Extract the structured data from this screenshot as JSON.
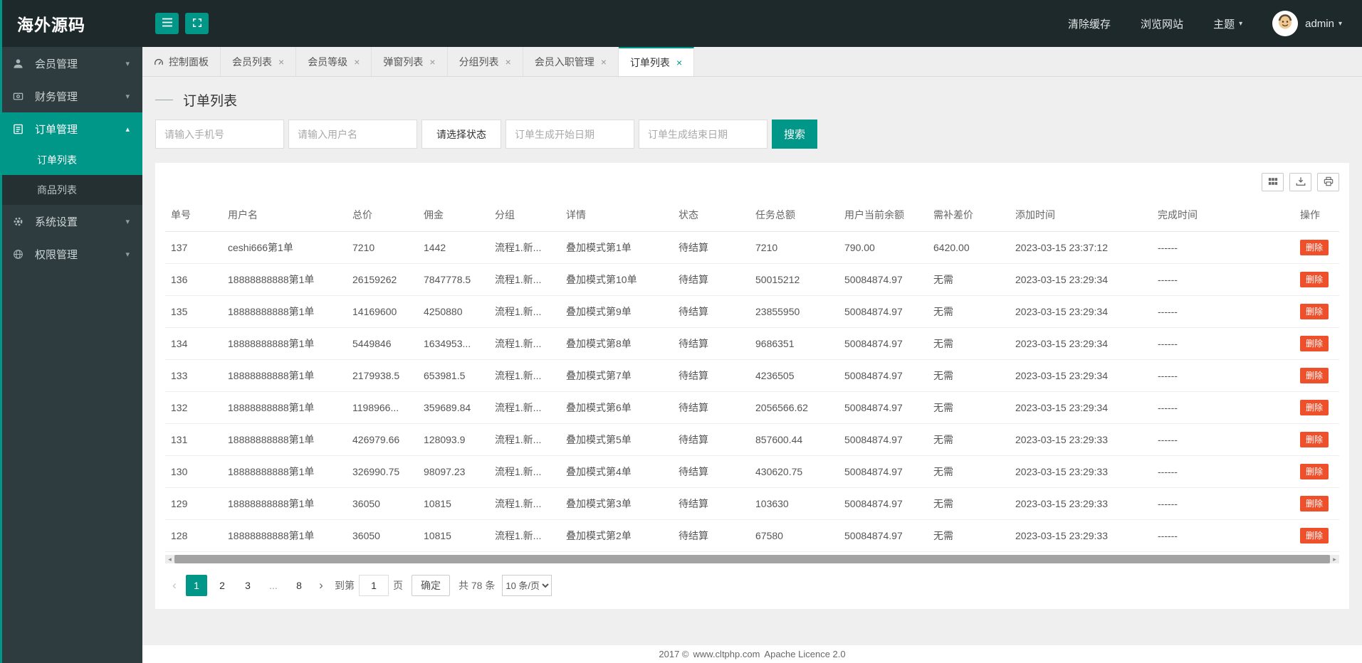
{
  "colors": {
    "accent": "#009688",
    "danger": "#ef502c",
    "topbar_bg": "#1e292c",
    "sidebar_bg": "#2f3c3f",
    "submenu_bg": "#253033"
  },
  "icons": {
    "close": "×",
    "caret_down": "▾",
    "caret_up": "▴",
    "prev": "‹",
    "next": "›",
    "scroll_left": "◂",
    "scroll_right": "▸"
  },
  "brand": {
    "logo_text": "海外源码"
  },
  "topbar": {
    "links": [
      {
        "id": "clear-cache",
        "label": "清除缓存"
      },
      {
        "id": "browse-site",
        "label": "浏览网站"
      }
    ],
    "theme": {
      "label": "主题"
    },
    "user": {
      "name": "admin"
    }
  },
  "sidebar": {
    "items": [
      {
        "id": "members",
        "label": "会员管理",
        "icon": "user-icon",
        "expanded": false,
        "active": false
      },
      {
        "id": "finance",
        "label": "财务管理",
        "icon": "finance-icon",
        "expanded": false,
        "active": false
      },
      {
        "id": "orders",
        "label": "订单管理",
        "icon": "order-icon",
        "expanded": true,
        "active": true,
        "children": [
          {
            "id": "order-list",
            "label": "订单列表",
            "active": true
          },
          {
            "id": "product-list",
            "label": "商品列表",
            "active": false
          }
        ]
      },
      {
        "id": "system",
        "label": "系统设置",
        "icon": "settings-icon",
        "expanded": false,
        "active": false
      },
      {
        "id": "permissions",
        "label": "权限管理",
        "icon": "globe-icon",
        "expanded": false,
        "active": false
      }
    ]
  },
  "tabs": [
    {
      "id": "dashboard",
      "label": "控制面板",
      "icon": "dashboard-icon",
      "closable": false,
      "active": false
    },
    {
      "id": "member-list",
      "label": "会员列表",
      "closable": true,
      "active": false
    },
    {
      "id": "member-level",
      "label": "会员等级",
      "closable": true,
      "active": false
    },
    {
      "id": "popup-list",
      "label": "弹窗列表",
      "closable": true,
      "active": false
    },
    {
      "id": "group-list",
      "label": "分组列表",
      "closable": true,
      "active": false
    },
    {
      "id": "member-onboarding",
      "label": "会员入职管理",
      "closable": true,
      "active": false
    },
    {
      "id": "order-list",
      "label": "订单列表",
      "closable": true,
      "active": true
    }
  ],
  "page": {
    "title": "订单列表"
  },
  "filters": {
    "phone_placeholder": "请输入手机号",
    "username_placeholder": "请输入用户名",
    "status_button_label": "请选择状态",
    "start_date_placeholder": "订单生成开始日期",
    "end_date_placeholder": "订单生成结束日期",
    "search_button_label": "搜索"
  },
  "toolbar_icons": [
    "columns-icon",
    "download-icon",
    "print-icon"
  ],
  "table": {
    "columns": [
      "单号",
      "用户名",
      "总价",
      "佣金",
      "分组",
      "详情",
      "状态",
      "任务总额",
      "用户当前余额",
      "需补差价",
      "添加时间",
      "完成时间",
      "操作"
    ],
    "delete_button_label": "删除",
    "rows": [
      [
        "137",
        "ceshi666第1单",
        "7210",
        "1442",
        "流程1.新...",
        "叠加模式第1单",
        "待结算",
        "7210",
        "790.00",
        "6420.00",
        "2023-03-15 23:37:12",
        "------"
      ],
      [
        "136",
        "18888888888第1单",
        "26159262",
        "7847778.5",
        "流程1.新...",
        "叠加模式第10单",
        "待结算",
        "50015212",
        "50084874.97",
        "无需",
        "2023-03-15 23:29:34",
        "------"
      ],
      [
        "135",
        "18888888888第1单",
        "14169600",
        "4250880",
        "流程1.新...",
        "叠加模式第9单",
        "待结算",
        "23855950",
        "50084874.97",
        "无需",
        "2023-03-15 23:29:34",
        "------"
      ],
      [
        "134",
        "18888888888第1单",
        "5449846",
        "1634953...",
        "流程1.新...",
        "叠加模式第8单",
        "待结算",
        "9686351",
        "50084874.97",
        "无需",
        "2023-03-15 23:29:34",
        "------"
      ],
      [
        "133",
        "18888888888第1单",
        "2179938.5",
        "653981.5",
        "流程1.新...",
        "叠加模式第7单",
        "待结算",
        "4236505",
        "50084874.97",
        "无需",
        "2023-03-15 23:29:34",
        "------"
      ],
      [
        "132",
        "18888888888第1单",
        "1198966...",
        "359689.84",
        "流程1.新...",
        "叠加模式第6单",
        "待结算",
        "2056566.62",
        "50084874.97",
        "无需",
        "2023-03-15 23:29:34",
        "------"
      ],
      [
        "131",
        "18888888888第1单",
        "426979.66",
        "128093.9",
        "流程1.新...",
        "叠加模式第5单",
        "待结算",
        "857600.44",
        "50084874.97",
        "无需",
        "2023-03-15 23:29:33",
        "------"
      ],
      [
        "130",
        "18888888888第1单",
        "326990.75",
        "98097.23",
        "流程1.新...",
        "叠加模式第4单",
        "待结算",
        "430620.75",
        "50084874.97",
        "无需",
        "2023-03-15 23:29:33",
        "------"
      ],
      [
        "129",
        "18888888888第1单",
        "36050",
        "10815",
        "流程1.新...",
        "叠加模式第3单",
        "待结算",
        "103630",
        "50084874.97",
        "无需",
        "2023-03-15 23:29:33",
        "------"
      ],
      [
        "128",
        "18888888888第1单",
        "36050",
        "10815",
        "流程1.新...",
        "叠加模式第2单",
        "待结算",
        "67580",
        "50084874.97",
        "无需",
        "2023-03-15 23:29:33",
        "------"
      ]
    ]
  },
  "pagination": {
    "pages": [
      {
        "label": "1",
        "active": true,
        "ellipsis": false
      },
      {
        "label": "2",
        "active": false,
        "ellipsis": false
      },
      {
        "label": "3",
        "active": false,
        "ellipsis": false
      },
      {
        "label": "...",
        "active": false,
        "ellipsis": true
      },
      {
        "label": "8",
        "active": false,
        "ellipsis": false
      }
    ],
    "goto_prefix": "到第",
    "goto_value": "1",
    "goto_suffix": "页",
    "confirm_label": "确定",
    "total_text": "共 78 条",
    "page_size_option": "10 条/页"
  },
  "footer": {
    "year": "2017 ©",
    "site": "www.cltphp.com",
    "license": "Apache Licence 2.0"
  }
}
